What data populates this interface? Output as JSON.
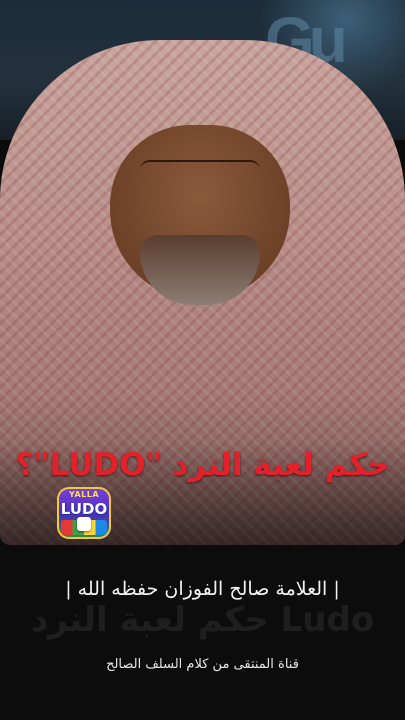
{
  "video": {
    "title": "حكم لعبة النرد \"LUDO\"؟",
    "scholar_caption": "| العلامة صالح الفوزان حفظه الله |",
    "channel_caption": "قناة المنتقى من كلام السلف الصالح",
    "background_text": "حكم لعبة النرد Ludo",
    "backdrop_letters": "Gu"
  },
  "app_logo": {
    "top_text": "YALLA",
    "main_text": "LUDO"
  },
  "colors": {
    "title": "#e4212a",
    "caption": "#f3f3f3",
    "panel": "#0c0c0d"
  }
}
